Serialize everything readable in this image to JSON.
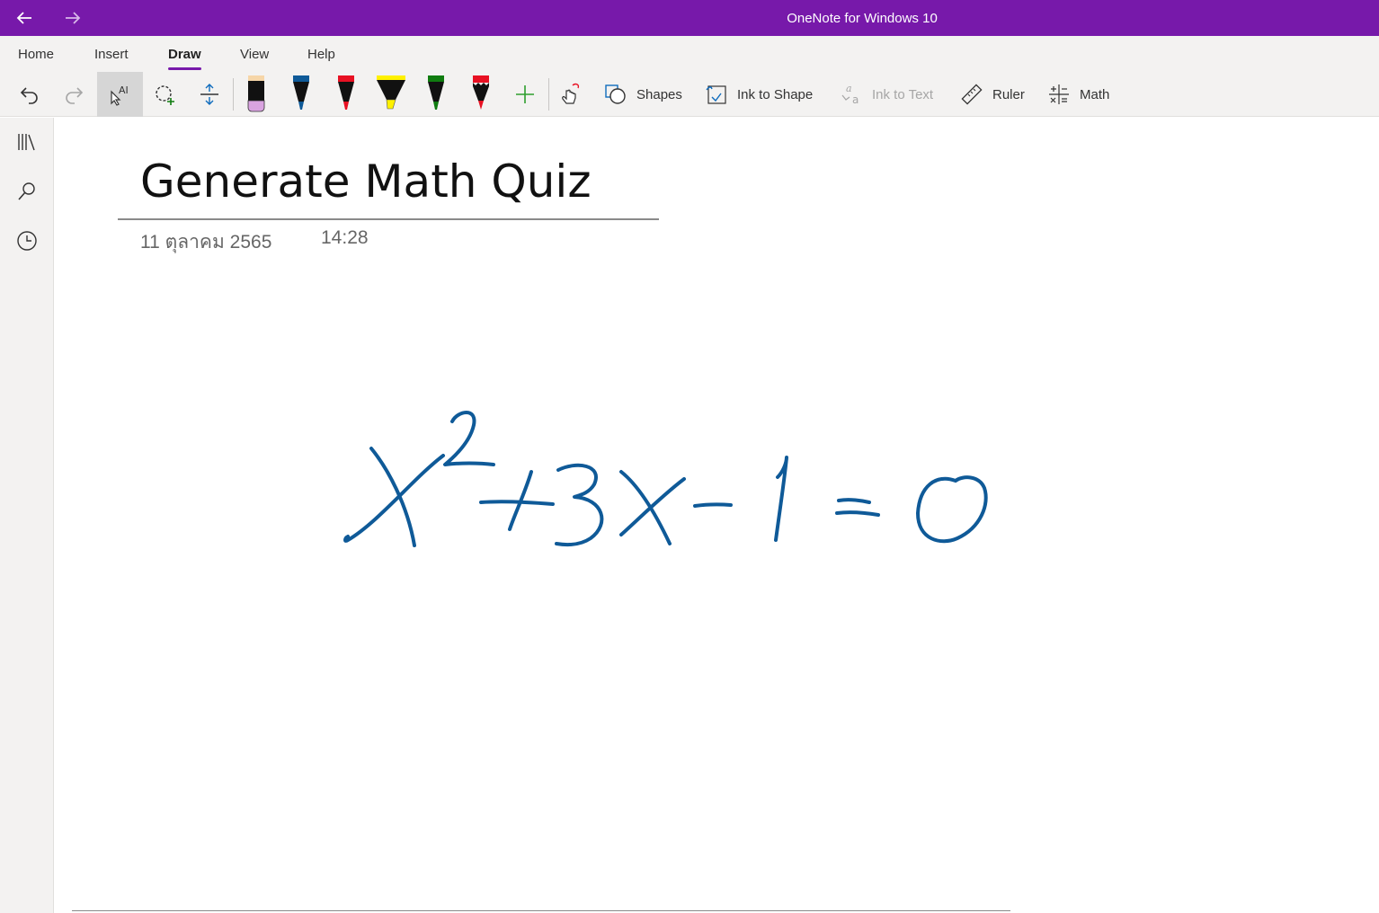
{
  "window": {
    "title": "OneNote for Windows 10"
  },
  "ribbon": {
    "tabs": [
      {
        "label": "Home"
      },
      {
        "label": "Insert"
      },
      {
        "label": "Draw"
      },
      {
        "label": "View"
      },
      {
        "label": "Help"
      }
    ],
    "active_tab": "Draw",
    "tools": {
      "shapes_label": "Shapes",
      "ink_to_shape_label": "Ink to Shape",
      "ink_to_text_label": "Ink to Text",
      "ruler_label": "Ruler",
      "math_label": "Math"
    },
    "pens": [
      {
        "icon": "eraser-pen-icon",
        "color": "#000000",
        "cap": "#d9a3e0"
      },
      {
        "icon": "pen-icon",
        "color": "#000000",
        "tip": "#0f5a98"
      },
      {
        "icon": "pen-icon",
        "color": "#000000",
        "tip": "#e81123"
      },
      {
        "icon": "highlighter-icon",
        "color": "#000000",
        "tip": "#fff100"
      },
      {
        "icon": "pen-icon",
        "color": "#000000",
        "tip": "#107c10"
      },
      {
        "icon": "pencil-icon",
        "color": "#000000",
        "tip": "#e81123"
      }
    ]
  },
  "page": {
    "title": "Generate Math Quiz",
    "date": "11 ตุลาคม 2565",
    "time": "14:28"
  },
  "colors": {
    "accent": "#7719aa",
    "ink": "#0f5a98"
  }
}
